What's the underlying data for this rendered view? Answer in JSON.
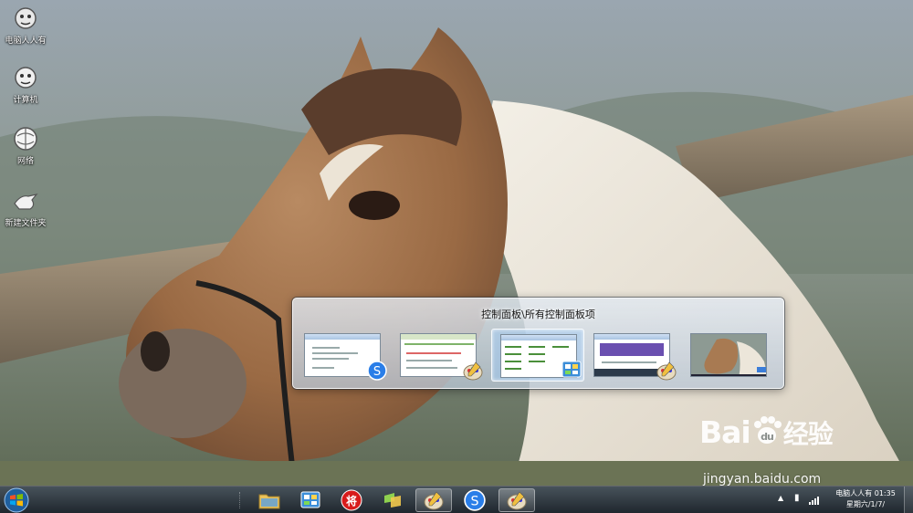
{
  "desktop": {
    "icons": [
      {
        "label": "电脑人人有",
        "icon": "user-folder-icon"
      },
      {
        "label": "计算机",
        "icon": "computer-icon"
      },
      {
        "label": "网络",
        "icon": "network-icon"
      },
      {
        "label": "新建文件夹",
        "icon": "folder-icon"
      }
    ],
    "wallpaper": "horse-wallpaper"
  },
  "switcher": {
    "title": "控制面板\\所有控制面板项",
    "selected_index": 2,
    "windows": [
      {
        "icon": "sogou-browser-icon"
      },
      {
        "icon": "paint-icon"
      },
      {
        "icon": "control-panel-icon"
      },
      {
        "icon": "paint-icon"
      },
      {
        "icon": "desktop-preview-icon"
      }
    ]
  },
  "taskbar": {
    "start_icon": "windows-orb-icon",
    "buttons": [
      {
        "icon": "explorer-folder-icon"
      },
      {
        "icon": "control-panel-icon"
      },
      {
        "icon": "xiangqi-jiang-icon",
        "glyph": "将"
      },
      {
        "icon": "tiles-app-icon"
      },
      {
        "icon": "paint-icon",
        "active": true
      },
      {
        "icon": "sogou-browser-icon"
      },
      {
        "icon": "paint-icon",
        "active": true
      }
    ],
    "tray": {
      "clock_line1": "电脑人人有 01:35",
      "clock_line2": "星期六/1/7/"
    }
  },
  "watermark": {
    "logo_text": "Bai",
    "logo_suffix": "经验",
    "url": "jingyan.baidu.com"
  },
  "colors": {
    "taskbar": "#1e2830",
    "switcher": "#c9d5e1",
    "selection": "#a0c8f0"
  }
}
